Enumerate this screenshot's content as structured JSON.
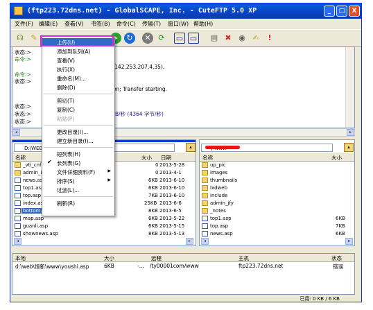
{
  "title": "(ftp223.72dns.net) - GlobalSCAPE, Inc. - CuteFTP 5.0 XP",
  "window_buttons": {
    "min": "_",
    "max": "□",
    "close": "X"
  },
  "menu": [
    "文件(F)",
    "编辑(E)",
    "查看(V)",
    "书签(B)",
    "命令(C)",
    "传输(T)",
    "窗口(W)",
    "帮助(H)"
  ],
  "toolbar_icons": [
    "connect-icon",
    "wizard-icon",
    "refresh-icon",
    "stop-icon",
    "folder-icon",
    "tool-icon",
    "go-icon",
    "reconnect-icon",
    "cancel-icon",
    "refresh2-icon",
    "local-icon",
    "remote-icon",
    "page-icon",
    "delete-icon",
    "view-icon",
    "edit-icon",
    "alert-icon"
  ],
  "log": [
    {
      "prefix": "状态:>",
      "text": "",
      "kind": "st"
    },
    {
      "prefix": "命令:>",
      "text": "",
      "kind": "cm"
    },
    {
      "prefix": "",
      "text": "",
      "kind": "st"
    },
    {
      "prefix": "",
      "text": "1,142,253,207,4,35).",
      "kind": "st"
    },
    {
      "prefix": "命令:>",
      "text": "",
      "kind": "cm"
    },
    {
      "prefix": "状态:>",
      "text": "",
      "kind": "st"
    },
    {
      "prefix": "",
      "text": "pen; Transfer starting.",
      "kind": "st"
    },
    {
      "prefix": "状态:>",
      "text": "",
      "kind": "st"
    },
    {
      "prefix": "状态:>",
      "text": "B/秒 (4364 字节/秒)",
      "kind": "bl"
    },
    {
      "prefix": "状态:>",
      "text": "",
      "kind": "st"
    }
  ],
  "local": {
    "path": "D:\\WEB\\",
    "columns": {
      "name": "名称",
      "size": "大小",
      "date": "日期"
    },
    "files": [
      {
        "name": "_vti_cnf",
        "size": "0",
        "date": "2013-5-28",
        "type": "folder"
      },
      {
        "name": "admin_ify",
        "size": "0",
        "date": "2013-4-1",
        "type": "folder"
      },
      {
        "name": "news.asp",
        "size": "6KB",
        "date": "2013-6-10",
        "type": "file"
      },
      {
        "name": "top1.asp",
        "size": "6KB",
        "date": "2013-6-10",
        "type": "file"
      },
      {
        "name": "top.asp",
        "size": "7KB",
        "date": "2013-6-10",
        "type": "file"
      },
      {
        "name": "index.asp",
        "size": "25KB",
        "date": "2013-6-6",
        "type": "file"
      },
      {
        "name": "bottom.as",
        "size": "8KB",
        "date": "2013-6-5",
        "type": "file",
        "selected": true
      },
      {
        "name": "map.asp",
        "size": "6KB",
        "date": "2013-5-22",
        "type": "file"
      },
      {
        "name": "guanli.asp",
        "size": "6KB",
        "date": "2013-5-15",
        "type": "file"
      },
      {
        "name": "shownews.asp",
        "size": "8KB",
        "date": "2013-5-13",
        "type": "file"
      }
    ]
  },
  "remote": {
    "path": "/ www",
    "columns": {
      "name": "名称",
      "size": "大小"
    },
    "files": [
      {
        "name": "up_pic",
        "size": "",
        "type": "folder"
      },
      {
        "name": "images",
        "size": "",
        "type": "folder"
      },
      {
        "name": "thumbnails",
        "size": "",
        "type": "folder"
      },
      {
        "name": "lxdweb",
        "size": "",
        "type": "folder"
      },
      {
        "name": "include",
        "size": "",
        "type": "folder"
      },
      {
        "name": "admin_jfy",
        "size": "",
        "type": "folder"
      },
      {
        "name": "_notes",
        "size": "",
        "type": "folder"
      },
      {
        "name": "top1.asp",
        "size": "6KB",
        "type": "file"
      },
      {
        "name": "top.asp",
        "size": "7KB",
        "type": "file"
      },
      {
        "name": "news.asp",
        "size": "6KB",
        "type": "file"
      }
    ]
  },
  "context_menu": [
    {
      "label": "上传(U)",
      "highlighted": true
    },
    {
      "label": "添加到队列(A)"
    },
    {
      "label": "查看(V)"
    },
    {
      "label": "执行(X)"
    },
    {
      "label": "重命名(M)..."
    },
    {
      "label": "删除(D)"
    },
    {
      "sep": true
    },
    {
      "label": "剪切(T)"
    },
    {
      "label": "复制(C)"
    },
    {
      "label": "粘贴(P)",
      "disabled": true
    },
    {
      "sep": true
    },
    {
      "label": "更改目录(I)..."
    },
    {
      "label": "建立新目录(I)..."
    },
    {
      "sep": true
    },
    {
      "label": "短列表(H)"
    },
    {
      "label": "长列表(G)",
      "checked": true
    },
    {
      "label": "文件详细资料(F)",
      "submenu": true
    },
    {
      "label": "排序(S)",
      "submenu": true
    },
    {
      "label": "过滤(L)..."
    },
    {
      "sep": true
    },
    {
      "label": "刷新(R)"
    }
  ],
  "queue": {
    "columns": {
      "local": "本地",
      "size": "大小",
      "remote": "远程",
      "host": "主机",
      "status": "状态"
    },
    "rows": [
      {
        "local": "d:\\web\\恒新\\www\\youshi.asp",
        "size": "6KB",
        "arrow": "-...",
        "remote": "/ty00001com/www",
        "host": "ftp223.72dns.net",
        "status": "错误"
      }
    ]
  },
  "status_text": "已用: 0 KB / 6 KB"
}
